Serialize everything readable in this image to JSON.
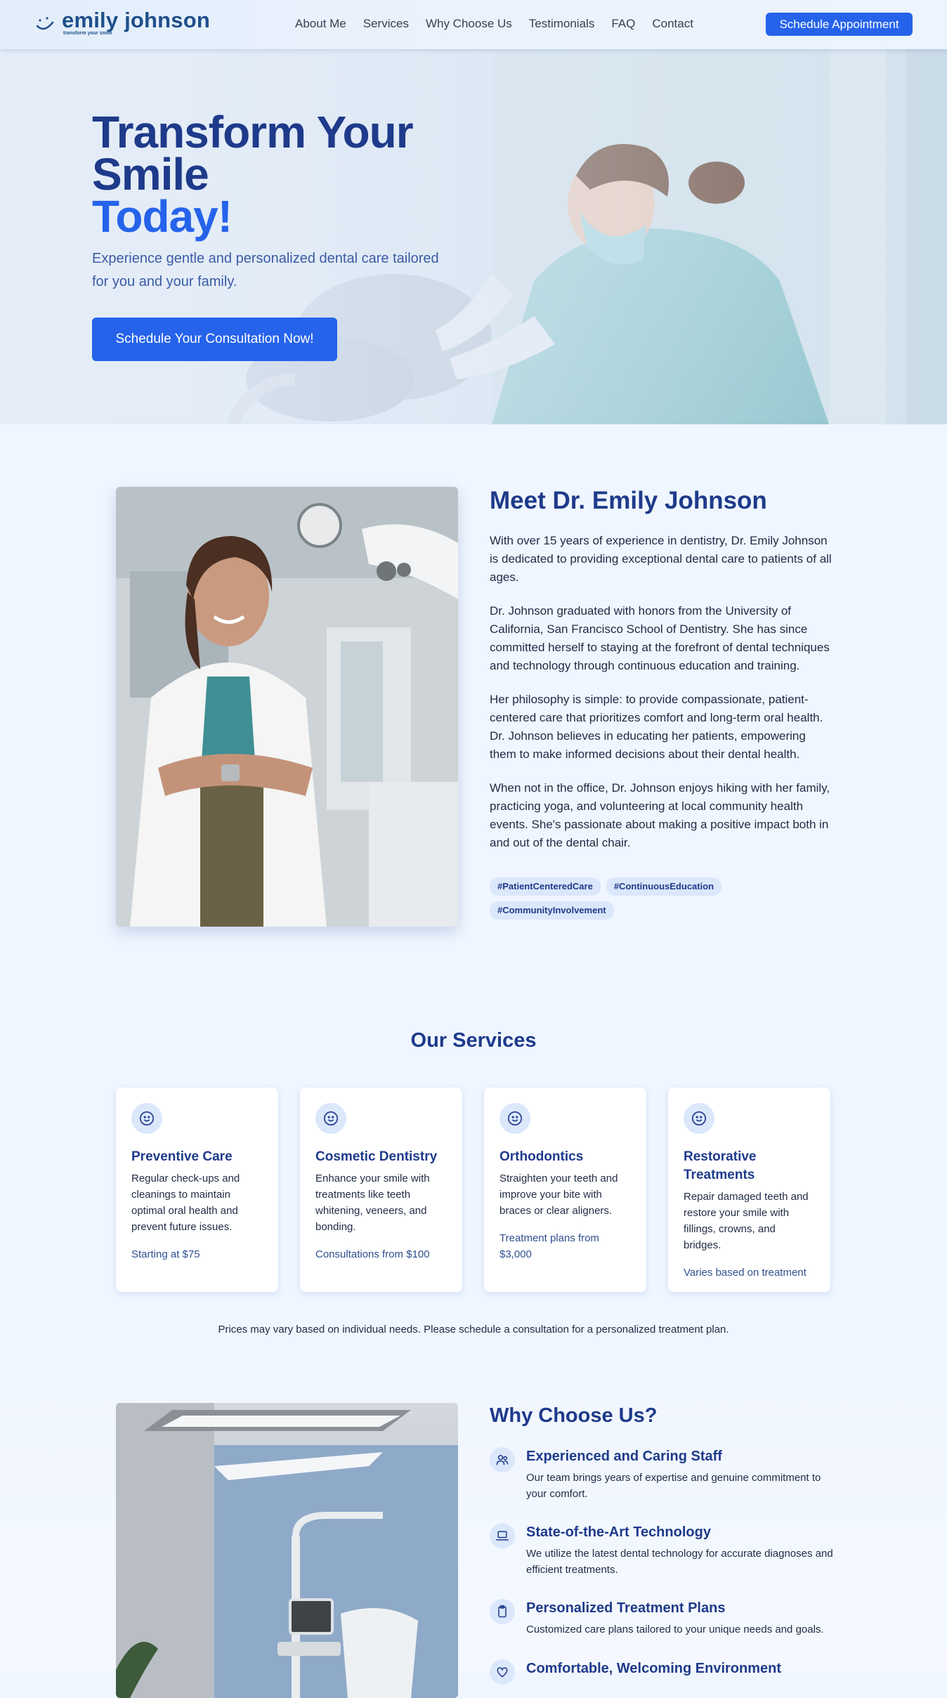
{
  "brand": {
    "name": "emily johnson",
    "tagline": "transform your smile"
  },
  "nav": {
    "links": [
      "About Me",
      "Services",
      "Why Choose Us",
      "Testimonials",
      "FAQ",
      "Contact"
    ],
    "cta": "Schedule Appointment"
  },
  "hero": {
    "title_line1": "Transform Your",
    "title_line2": "Smile",
    "title_accent": "Today!",
    "subtitle": "Experience gentle and personalized dental care tailored for you and your family.",
    "cta": "Schedule Your Consultation Now!"
  },
  "about": {
    "title": "Meet Dr. Emily Johnson",
    "paragraphs": [
      "With over 15 years of experience in dentistry, Dr. Emily Johnson is dedicated to providing exceptional dental care to patients of all ages.",
      "Dr. Johnson graduated with honors from the University of California, San Francisco School of Dentistry. She has since committed herself to staying at the forefront of dental techniques and technology through continuous education and training.",
      "Her philosophy is simple: to provide compassionate, patient-centered care that prioritizes comfort and long-term oral health. Dr. Johnson believes in educating her patients, empowering them to make informed decisions about their dental health.",
      "When not in the office, Dr. Johnson enjoys hiking with her family, practicing yoga, and volunteering at local community health events. She's passionate about making a positive impact both in and out of the dental chair."
    ],
    "tags": [
      "#PatientCenteredCare",
      "#ContinuousEducation",
      "#CommunityInvolvement"
    ]
  },
  "services": {
    "title": "Our Services",
    "items": [
      {
        "icon": "smile-icon",
        "title": "Preventive Care",
        "desc": "Regular check-ups and cleanings to maintain optimal oral health and prevent future issues.",
        "price": "Starting at $75"
      },
      {
        "icon": "smile-icon",
        "title": "Cosmetic Dentistry",
        "desc": "Enhance your smile with treatments like teeth whitening, veneers, and bonding.",
        "price": "Consultations from $100"
      },
      {
        "icon": "smile-icon",
        "title": "Orthodontics",
        "desc": "Straighten your teeth and improve your bite with braces or clear aligners.",
        "price": "Treatment plans from $3,000"
      },
      {
        "icon": "smile-icon",
        "title": "Restorative Treatments",
        "desc": "Repair damaged teeth and restore your smile with fillings, crowns, and bridges.",
        "price": "Varies based on treatment"
      }
    ],
    "note": "Prices may vary based on individual needs. Please schedule a consultation for a personalized treatment plan."
  },
  "why": {
    "title": "Why Choose Us?",
    "features": [
      {
        "icon": "users-icon",
        "title": "Experienced and Caring Staff",
        "desc": "Our team brings years of expertise and genuine commitment to your comfort."
      },
      {
        "icon": "laptop-icon",
        "title": "State-of-the-Art Technology",
        "desc": "We utilize the latest dental technology for accurate diagnoses and efficient treatments."
      },
      {
        "icon": "clipboard-icon",
        "title": "Personalized Treatment Plans",
        "desc": "Customized care plans tailored to your unique needs and goals."
      },
      {
        "icon": "heart-icon",
        "title": "Comfortable, Welcoming Environment",
        "desc": ""
      }
    ]
  },
  "colors": {
    "primary": "#2563eb",
    "navy": "#1e3a8a",
    "background": "#eff6ff",
    "tag_bg": "#dbe7fb"
  }
}
